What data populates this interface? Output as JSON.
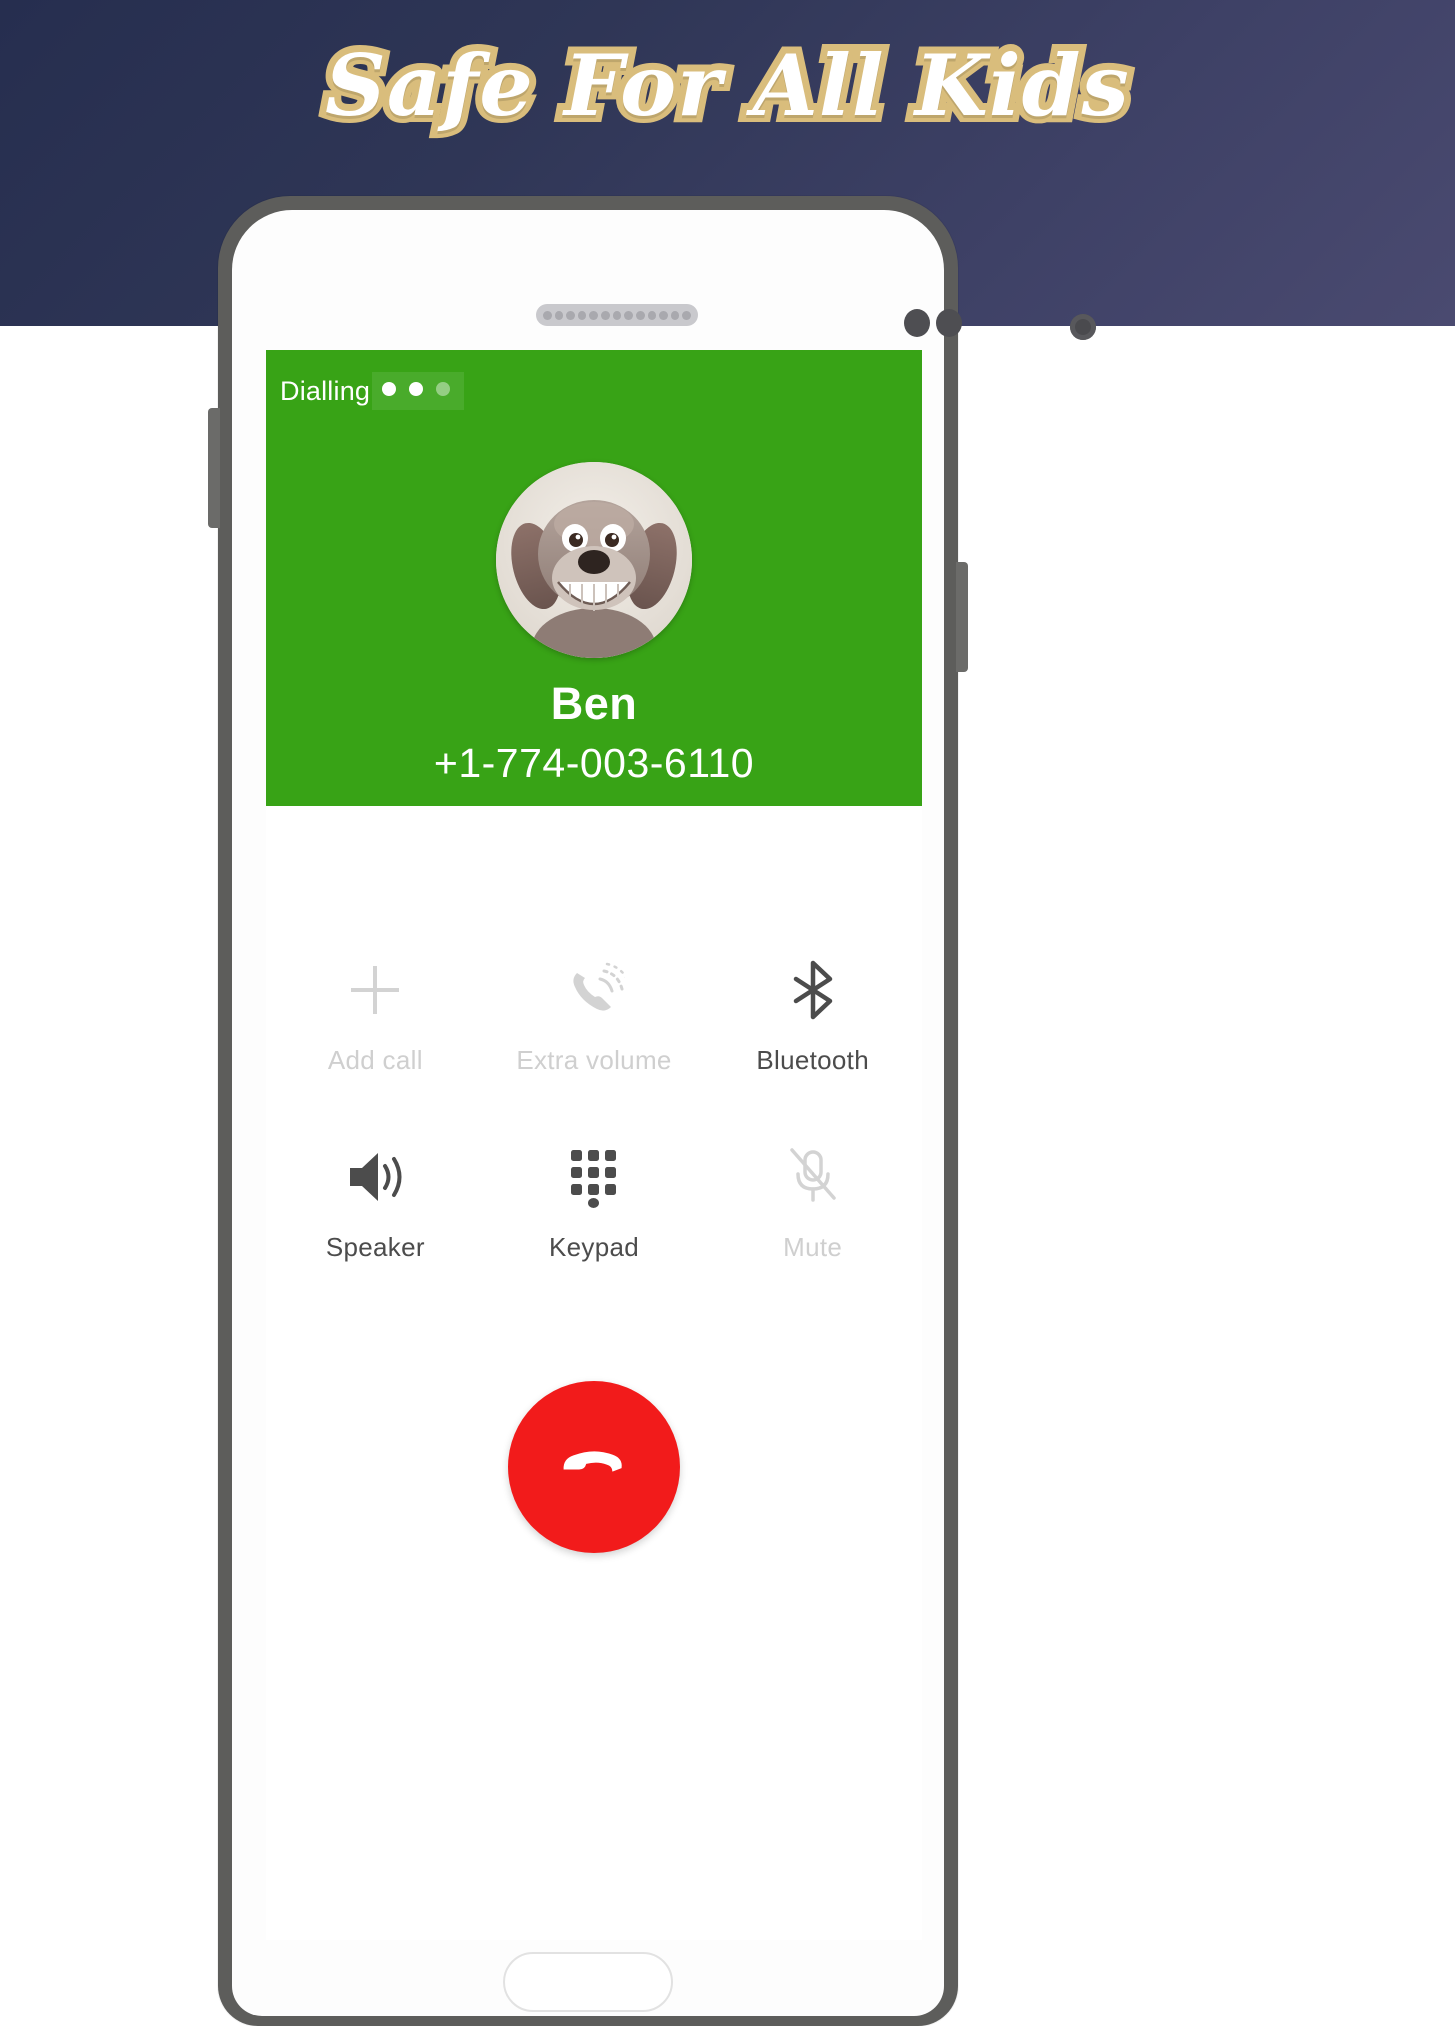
{
  "banner": {
    "title": "Safe For All Kids",
    "background_start": "#262e4f",
    "background_end": "#4a4a70",
    "title_color": "#ffffff",
    "title_outline_color": "#d9bd7c"
  },
  "phone": {
    "frame_color": "#5d5d5b",
    "body_color": "#fdfdfd",
    "hardware": {
      "earpiece_speaker": "speaker-grille",
      "sensor_dots": 2,
      "front_camera": "front-camera-lens",
      "volume_button": "volume-button",
      "power_button": "power-button",
      "home_button": "home-button"
    }
  },
  "call_screen": {
    "header_color": "#38a316",
    "status": "Dialling",
    "status_dots": [
      "on",
      "on",
      "dim"
    ],
    "avatar_alt": "dog-avatar",
    "contact_name": "Ben",
    "contact_number": "+1-774-003-6110",
    "controls": [
      [
        {
          "label": "Add call",
          "icon": "plus-icon",
          "state": "off"
        },
        {
          "label": "Extra volume",
          "icon": "call-volume-icon",
          "state": "off"
        },
        {
          "label": "Bluetooth",
          "icon": "bluetooth-icon",
          "state": "on"
        }
      ],
      [
        {
          "label": "Speaker",
          "icon": "speaker-icon",
          "state": "on"
        },
        {
          "label": "Keypad",
          "icon": "keypad-icon",
          "state": "on"
        },
        {
          "label": "Mute",
          "icon": "mute-mic-icon",
          "state": "off"
        }
      ]
    ],
    "end_call": {
      "label": "End call",
      "icon": "end-call-handset-icon",
      "color": "#f21b1b"
    }
  }
}
